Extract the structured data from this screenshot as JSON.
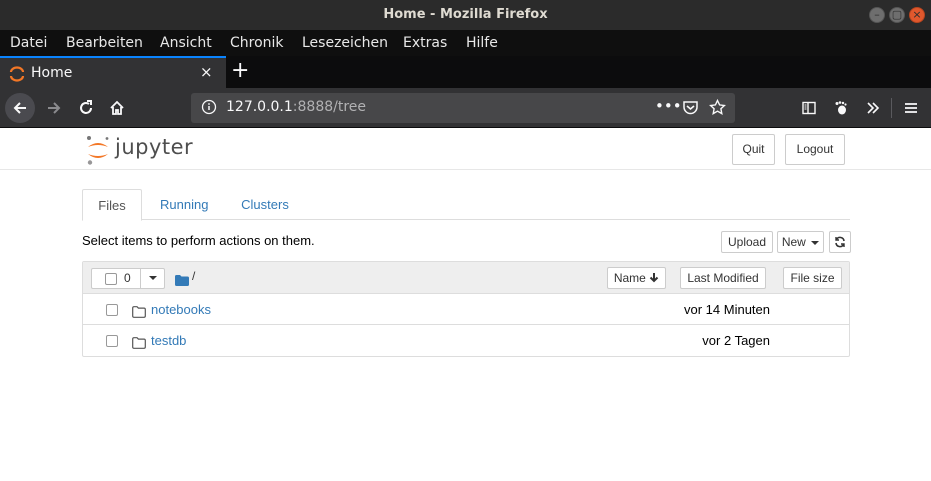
{
  "window": {
    "title": "Home - Mozilla Firefox"
  },
  "menu": [
    "Datei",
    "Bearbeiten",
    "Ansicht",
    "Chronik",
    "Lesezeichen",
    "Extras",
    "Hilfe"
  ],
  "browser_tab": {
    "title": "Home",
    "close": "×"
  },
  "new_tab": "+",
  "url": {
    "host": "127.0.0.1",
    "rest": ":8888/tree"
  },
  "jupyter": {
    "logo_text": "jupyter",
    "quit": "Quit",
    "logout": "Logout",
    "tabs": [
      "Files",
      "Running",
      "Clusters"
    ],
    "hint": "Select items to perform actions on them.",
    "upload": "Upload",
    "new": "New",
    "selected_count": "0",
    "breadcrumb": "/",
    "sort": {
      "name": "Name",
      "last_modified": "Last Modified",
      "file_size": "File size"
    },
    "files": [
      {
        "name": "notebooks",
        "modified": "vor 14 Minuten"
      },
      {
        "name": "testdb",
        "modified": "vor 2 Tagen"
      }
    ]
  },
  "colors": {
    "accent": "#0a84ff",
    "link": "#337ab7",
    "jupyter_orange": "#f37726"
  }
}
